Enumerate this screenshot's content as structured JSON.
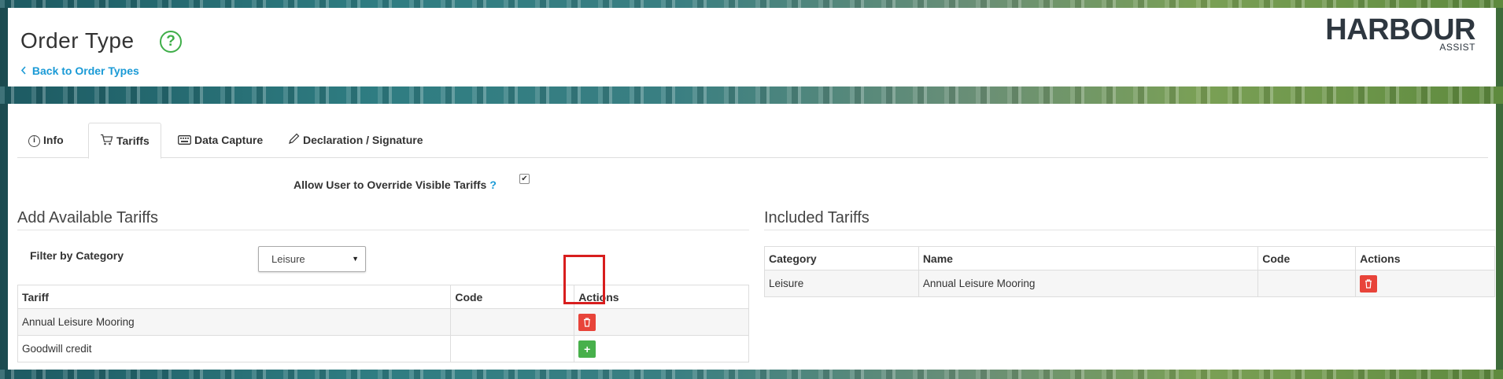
{
  "header": {
    "title": "Order Type",
    "help_glyph": "?",
    "back_link": "Back to Order Types",
    "logo_main": "HARBOUR",
    "logo_sub": "ASSIST"
  },
  "tabs": [
    {
      "label": "Info",
      "icon": "info-icon"
    },
    {
      "label": "Tariffs",
      "icon": "cart-icon"
    },
    {
      "label": "Data Capture",
      "icon": "keyboard-icon"
    },
    {
      "label": "Declaration / Signature",
      "icon": "pen-icon"
    }
  ],
  "active_tab": "Tariffs",
  "override": {
    "label": "Allow User to Override Visible Tariffs",
    "help": "?",
    "checked": true
  },
  "available": {
    "title": "Add Available Tariffs",
    "filter_label": "Filter by Category",
    "filter_value": "Leisure",
    "columns": [
      "Tariff",
      "Code",
      "Actions"
    ],
    "rows": [
      {
        "tariff": "Annual Leisure Mooring",
        "code": "",
        "action": "delete"
      },
      {
        "tariff": "Goodwill credit",
        "code": "",
        "action": "add"
      }
    ]
  },
  "included": {
    "title": "Included Tariffs",
    "columns": [
      "Category",
      "Name",
      "Code",
      "Actions"
    ],
    "rows": [
      {
        "category": "Leisure",
        "name": "Annual Leisure Mooring",
        "code": "",
        "action": "delete"
      }
    ]
  },
  "colors": {
    "accent_blue": "#1a9ad6",
    "help_green": "#3fae49",
    "delete_red": "#e8443a",
    "add_green": "#47b04b",
    "highlight_red": "#d81e1e"
  }
}
